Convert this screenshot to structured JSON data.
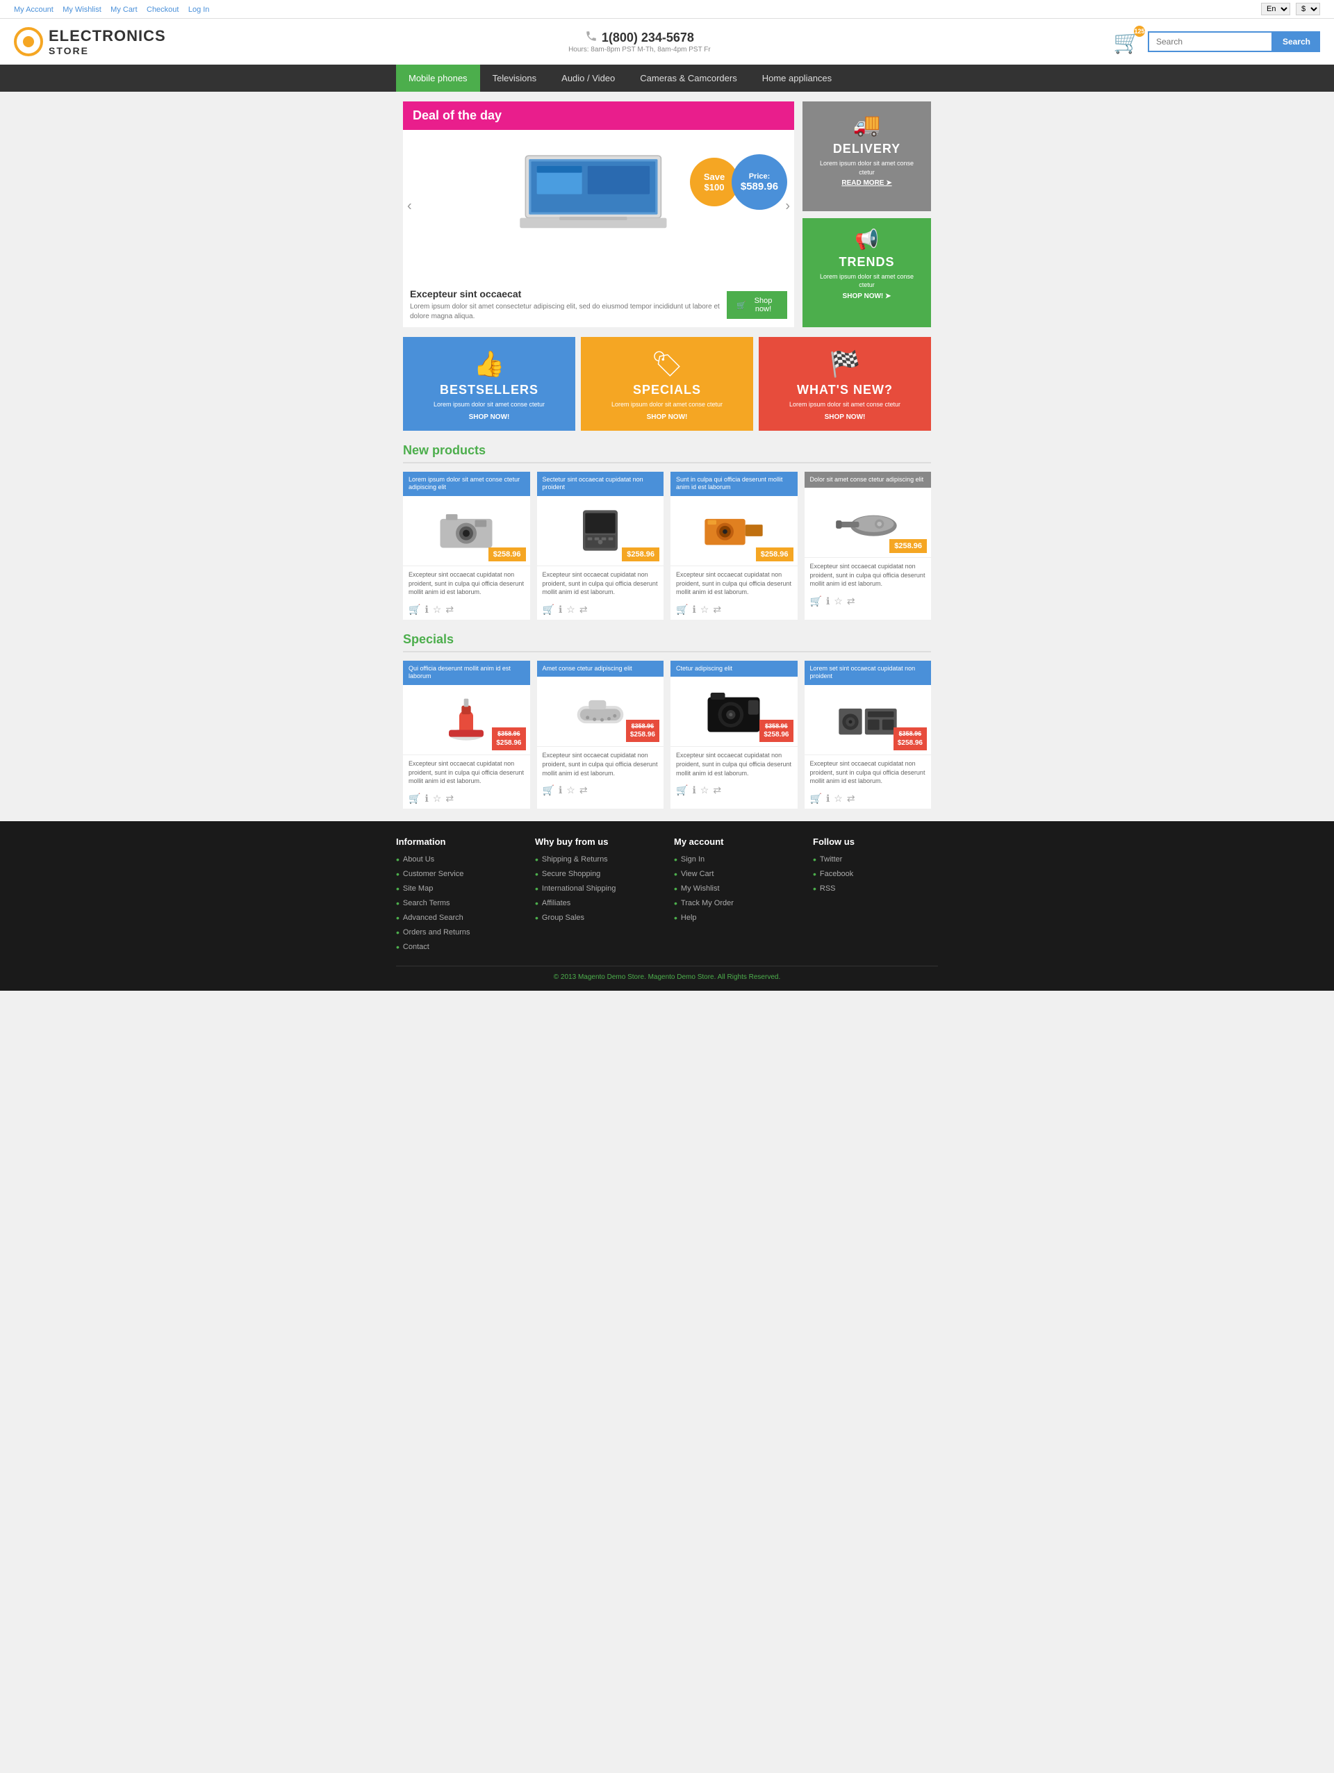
{
  "topbar": {
    "links": [
      "My Account",
      "My Wishlist",
      "My Cart",
      "Checkout",
      "Log In"
    ],
    "lang": "En",
    "currency": "$"
  },
  "header": {
    "logo": {
      "brand": "ELECTRONICS",
      "sub": "STORE"
    },
    "phone": "1(800) 234-5678",
    "hours": "Hours: 8am-8pm PST M-Th, 8am-4pm PST Fr",
    "cart_count": "125",
    "search_placeholder": "Search",
    "search_btn": "Search"
  },
  "nav": {
    "items": [
      "Mobile phones",
      "Televisions",
      "Audio / Video",
      "Cameras & Camcorders",
      "Home appliances"
    ],
    "active": 0
  },
  "deal": {
    "header": "Deal of the day",
    "save_label": "Save",
    "save_amount": "$100",
    "price_label": "Price:",
    "price_value": "$589.96",
    "product_title": "Excepteur sint occaecat",
    "product_desc": "Lorem ipsum dolor sit amet consectetur adipiscing elit, sed do eiusmod tempor incididunt ut labore et dolore magna aliqua.",
    "shop_now": "Shop now!",
    "delivery": {
      "title": "DELIVERY",
      "desc": "Lorem ipsum dolor sit amet conse ctetur",
      "read_more": "READ MORE"
    },
    "trends": {
      "title": "TRENDS",
      "desc": "Lorem ipsum dolor sit amet conse ctetur",
      "shop_now": "SHOP NOW!"
    }
  },
  "categories": [
    {
      "title": "BESTSELLERS",
      "desc": "Lorem ipsum dolor sit amet conse ctetur",
      "shop": "SHOP NOW!",
      "color": "blue"
    },
    {
      "title": "SPECIALS",
      "desc": "Lorem ipsum dolor sit amet conse ctetur",
      "shop": "SHOP NOW!",
      "color": "yellow"
    },
    {
      "title": "WHAT'S NEW?",
      "desc": "Lorem ipsum dolor sit amet conse ctetur",
      "shop": "SHOP NOW!",
      "color": "red"
    }
  ],
  "new_products": {
    "title": "New products",
    "items": [
      {
        "tag": "Lorem ipsum dolor sit amet conse ctetur adipiscing elit",
        "price": "$258.96",
        "desc": "Excepteur sint occaecat cupidatat non proident, sunt in culpa qui officia deserunt mollit anim id est laborum.",
        "tag_color": "blue"
      },
      {
        "tag": "Sectetur sint occaecat cupidatat non proident",
        "price": "$258.96",
        "desc": "Excepteur sint occaecat cupidatat non proident, sunt in culpa qui officia deserunt mollit anim id est laborum.",
        "tag_color": "blue"
      },
      {
        "tag": "Sunt in culpa qui officia deserunt mollit anim id est laborum",
        "price": "$258.96",
        "desc": "Excepteur sint occaecat cupidatat non proident, sunt in culpa qui officia deserunt mollit anim id est laborum.",
        "tag_color": "blue"
      },
      {
        "tag": "Dolor sit amet conse ctetur adipiscing elit",
        "price": "$258.96",
        "desc": "Excepteur sint occaecat cupidatat non proident, sunt in culpa qui officia deserunt mollit anim id est laborum.",
        "tag_color": "gray"
      }
    ]
  },
  "specials": {
    "title": "Specials",
    "items": [
      {
        "tag": "Qui officia deserunt mollit anim id est laborum",
        "price_old": "$358.96",
        "price_new": "$258.96",
        "desc": "Excepteur sint occaecat cupidatat non proident, sunt in culpa qui officia deserunt mollit anim id est laborum.",
        "tag_color": "blue"
      },
      {
        "tag": "Amet conse ctetur adipiscing elit",
        "price_old": "$358.96",
        "price_new": "$258.96",
        "desc": "Excepteur sint occaecat cupidatat non proident, sunt in culpa qui officia deserunt mollit anim id est laborum.",
        "tag_color": "blue"
      },
      {
        "tag": "Ctetur adipiscing elit",
        "price_old": "$358.96",
        "price_new": "$258.96",
        "desc": "Excepteur sint occaecat cupidatat non proident, sunt in culpa qui officia deserunt mollit anim id est laborum.",
        "tag_color": "blue"
      },
      {
        "tag": "Lorem set sint occaecat cupidatat non proident",
        "price_old": "$358.96",
        "price_new": "$258.96",
        "desc": "Excepteur sint occaecat cupidatat non proident, sunt in culpa qui officia deserunt mollit anim id est laborum.",
        "tag_color": "blue"
      }
    ]
  },
  "footer": {
    "information": {
      "title": "Information",
      "links": [
        "About Us",
        "Customer Service",
        "Site Map",
        "Search Terms",
        "Advanced Search",
        "Orders and Returns",
        "Contact"
      ]
    },
    "why": {
      "title": "Why buy from us",
      "links": [
        "Shipping & Returns",
        "Secure Shopping",
        "International Shipping",
        "Affiliates",
        "Group Sales"
      ]
    },
    "account": {
      "title": "My account",
      "links": [
        "Sign In",
        "View Cart",
        "My Wishlist",
        "Track My Order",
        "Help"
      ]
    },
    "follow": {
      "title": "Follow us",
      "links": [
        "Twitter",
        "Facebook",
        "RSS"
      ]
    },
    "copyright": "© 2013 Magento Demo Store.",
    "rights": " All Rights Reserved."
  }
}
